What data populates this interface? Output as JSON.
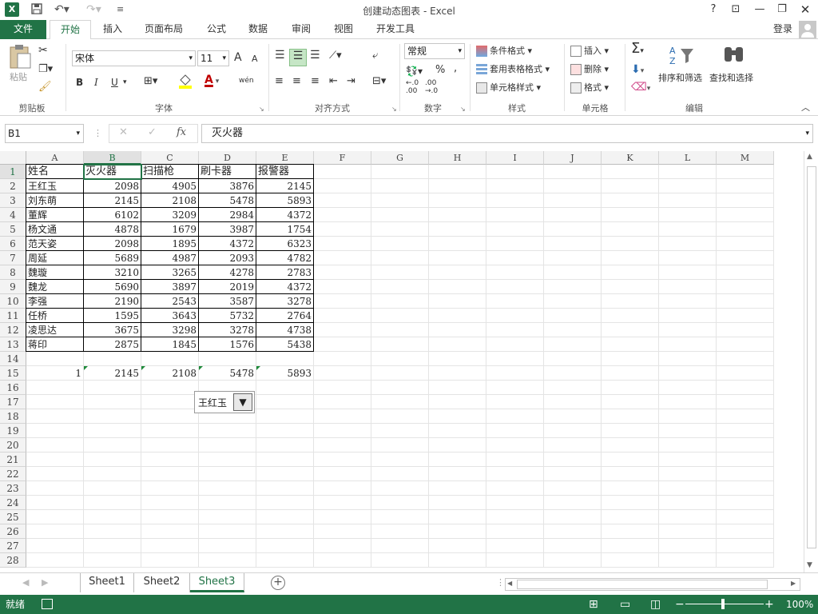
{
  "window": {
    "title": "创建动态图表 - Excel",
    "logo": "X",
    "help": "?",
    "login": "登录"
  },
  "tabs": [
    "文件",
    "开始",
    "插入",
    "页面布局",
    "公式",
    "数据",
    "审阅",
    "视图",
    "开发工具"
  ],
  "ribbon": {
    "clipboard": {
      "paste": "粘贴",
      "label": "剪贴板"
    },
    "font": {
      "name": "宋体",
      "size": "11",
      "bold": "B",
      "italic": "I",
      "underline": "U",
      "grow": "A",
      "shrink": "A",
      "color_letter": "A",
      "pinyin": "wén",
      "label": "字体"
    },
    "align": {
      "label": "对齐方式"
    },
    "number": {
      "format": "常规",
      "percent": "%",
      "comma": ",",
      "label": "数字"
    },
    "styles": {
      "cond": "条件格式",
      "table": "套用表格格式",
      "cell": "单元格样式",
      "label": "样式"
    },
    "cells": {
      "insert": "插入",
      "delete": "删除",
      "format": "格式",
      "label": "单元格"
    },
    "editing": {
      "sort": "排序和筛选",
      "find": "查找和选择",
      "label": "编辑"
    }
  },
  "formula_bar": {
    "name_box": "B1",
    "cancel": "✕",
    "enter": "✓",
    "fx": "fx",
    "content": "灭火器"
  },
  "columns": [
    "A",
    "B",
    "C",
    "D",
    "E",
    "F",
    "G",
    "H",
    "I",
    "J",
    "K",
    "L",
    "M"
  ],
  "rows": [
    "1",
    "2",
    "3",
    "4",
    "5",
    "6",
    "7",
    "8",
    "9",
    "10",
    "11",
    "12",
    "13",
    "14",
    "15",
    "16",
    "17",
    "18",
    "19",
    "20",
    "21",
    "22",
    "23",
    "24",
    "25",
    "26",
    "27",
    "28"
  ],
  "table": {
    "headers": [
      "姓名",
      "灭火器",
      "扫描枪",
      "刷卡器",
      "报警器"
    ],
    "data": [
      [
        "王红玉",
        "2098",
        "4905",
        "3876",
        "2145"
      ],
      [
        "刘东萌",
        "2145",
        "2108",
        "5478",
        "5893"
      ],
      [
        "董辉",
        "6102",
        "3209",
        "2984",
        "4372"
      ],
      [
        "杨文通",
        "4878",
        "1679",
        "3987",
        "1754"
      ],
      [
        "范天姿",
        "2098",
        "1895",
        "4372",
        "6323"
      ],
      [
        "周延",
        "5689",
        "4987",
        "2093",
        "4782"
      ],
      [
        "魏璇",
        "3210",
        "3265",
        "4278",
        "2783"
      ],
      [
        "魏龙",
        "5690",
        "3897",
        "2019",
        "4372"
      ],
      [
        "李强",
        "2190",
        "2543",
        "3587",
        "3278"
      ],
      [
        "任桥",
        "1595",
        "3643",
        "5732",
        "2764"
      ],
      [
        "凌思达",
        "3675",
        "3298",
        "3278",
        "4738"
      ],
      [
        "蒋印",
        "2875",
        "1845",
        "1576",
        "5438"
      ]
    ]
  },
  "row15": [
    "1",
    "2145",
    "2108",
    "5478",
    "5893"
  ],
  "combo": {
    "value": "王红玉"
  },
  "sheets": [
    "Sheet1",
    "Sheet2",
    "Sheet3"
  ],
  "active_sheet": "Sheet3",
  "status": {
    "ready": "就绪",
    "zoom": "100%"
  }
}
